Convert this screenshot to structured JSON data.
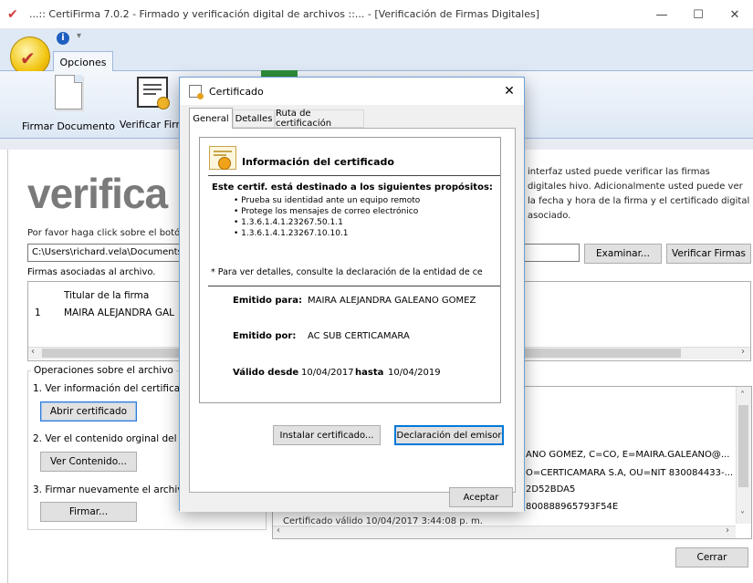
{
  "window": {
    "title": "...:: CertiFirma 7.0.2 - Firmado y verificación digital de archivos ::... - [Verificación de Firmas Digitales]",
    "minimize": "—",
    "maximize": "☐",
    "close": "✕"
  },
  "ribbon": {
    "tab": "Opciones",
    "firmar_label": "Firmar Documento",
    "verificar_label": "Verificar Firm"
  },
  "main": {
    "logo": "verifica",
    "description": "interfaz usted puede verificar las firmas digitales hivo.  Adicionalmente usted puede ver la fecha y hora de la firma y el certificado digital asociado.",
    "instruction": "Por favor haga click sobre el botón",
    "path_value": "C:\\Users\\richard.vela\\Documents",
    "examinar_label": "Examinar...",
    "verificar_firmas_label": "Verificar Firmas",
    "firmas_label": "Firmas asociadas al archivo.",
    "grid_header": "Titular de la firma",
    "grid_rows": [
      {
        "num": "1",
        "name": "MAIRA ALEJANDRA GAL"
      }
    ]
  },
  "operations": {
    "legend": "Operaciones sobre el archivo",
    "step1": "1. Ver información del certificado",
    "step1_button": "Abrir certificado",
    "step2": "2. Ver el contenido orginal del ar",
    "step2_button": "Ver Contenido...",
    "step3": "3. Firmar nuevamente el archivo v",
    "step3_button": "Firmar..."
  },
  "info_panel": {
    "line1": "ANO GOMEZ, C=CO, E=MAIRA.GALEANO@...",
    "line2": "O=CERTICAMARA S.A, OU=NIT 830084433-...",
    "line3": "2D52BDA5",
    "line4": "800888965793F54E",
    "bottom_line": "Certificado válido     10/04/2017 3:44:08 p. m."
  },
  "cerrar_label": "Cerrar",
  "dialog": {
    "title": "Certificado",
    "close": "✕",
    "tabs": [
      "General",
      "Detalles",
      "Ruta de certificación"
    ],
    "info_heading": "Información del certificado",
    "purpose_heading": "Este certif. está destinado a los siguientes propósitos:",
    "purposes": [
      "• Prueba su identidad ante un equipo remoto",
      "• Protege los mensajes de correo electrónico",
      "• 1.3.6.1.4.1.23267.50.1.1",
      "• 1.3.6.1.4.1.23267.10.10.1"
    ],
    "note": "* Para ver detalles, consulte la declaración de la entidad de ce",
    "issued_to_label": "Emitido para:",
    "issued_to": "MAIRA ALEJANDRA GALEANO GOMEZ",
    "issued_by_label": "Emitido por:",
    "issued_by": "AC SUB CERTICAMARA",
    "valid_from_label": "Válido desde",
    "valid_from": "10/04/2017",
    "valid_to_label": "hasta",
    "valid_to": "10/04/2019",
    "install_button": "Instalar certificado...",
    "issuer_statement_button": "Declaración del emisor",
    "accept_button": "Aceptar"
  }
}
